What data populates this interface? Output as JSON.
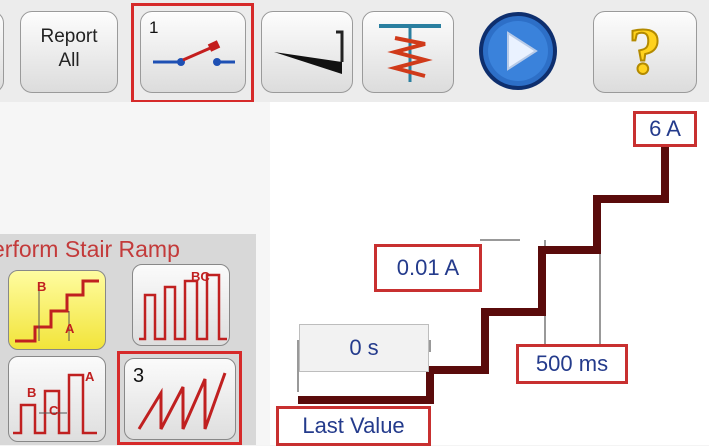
{
  "toolbar": {
    "report_label_line1": "Report",
    "report_label_line2": "All",
    "breaker_index": "1"
  },
  "graph": {
    "final_current": "6 A",
    "step_current": "0.01 A",
    "initial_time": "0 s",
    "step_time": "500 ms",
    "start_mode": "Last Value"
  },
  "stair_ramp": {
    "title": "erform Stair Ramp",
    "label_b": "B",
    "label_a": "A",
    "label_bc": "BC",
    "label_c": "C",
    "mode3_index": "3"
  },
  "colors": {
    "accent_red": "#d62a2a",
    "step_line": "#5a0b0b",
    "value_text": "#243b8c",
    "selected_mode": "#f2e43a"
  }
}
